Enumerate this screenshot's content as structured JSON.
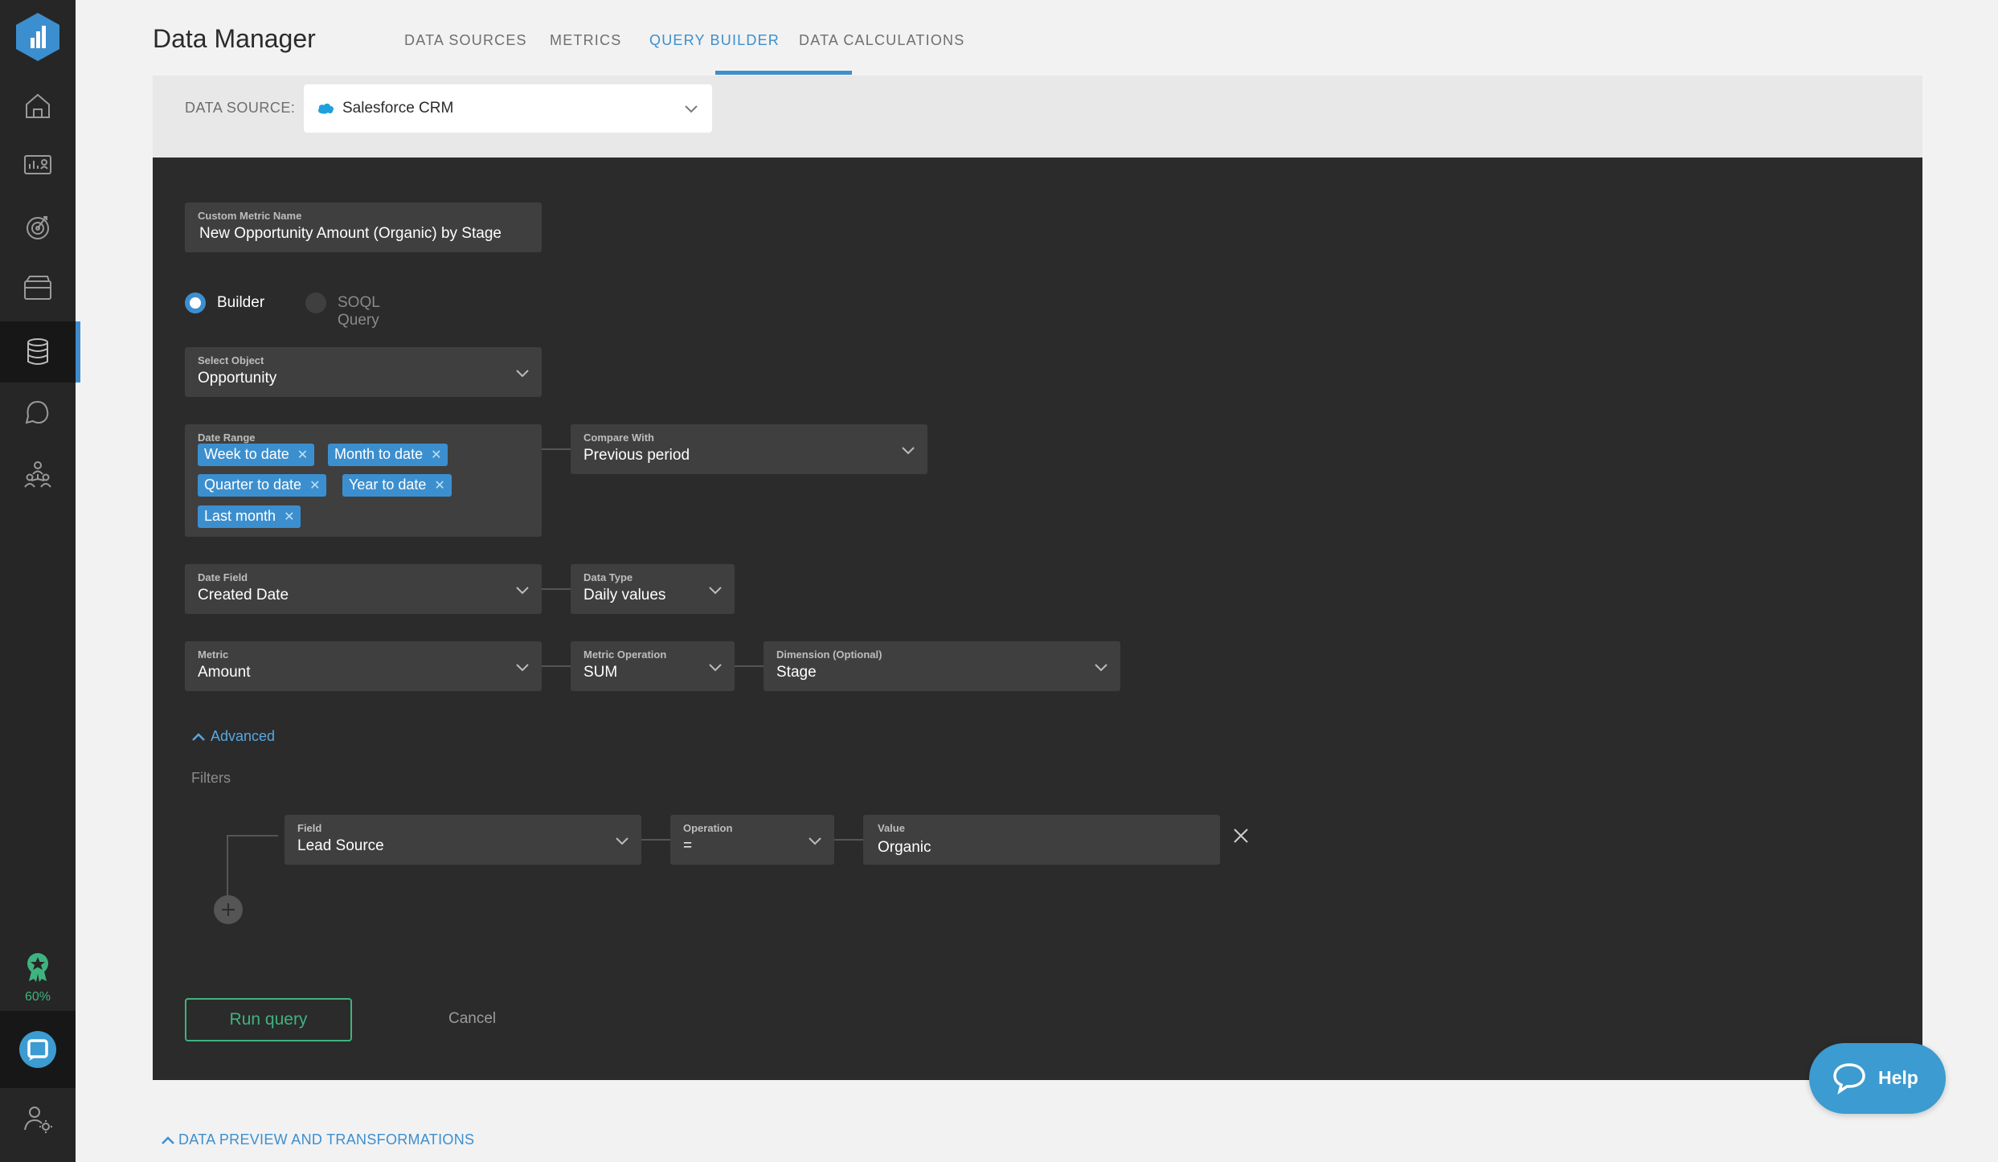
{
  "app": {
    "title": "Data Manager"
  },
  "tabs": [
    {
      "label": "DATA SOURCES"
    },
    {
      "label": "METRICS"
    },
    {
      "label": "QUERY BUILDER"
    },
    {
      "label": "DATA CALCULATIONS"
    }
  ],
  "active_tab": "QUERY BUILDER",
  "sidebar": {
    "items": [
      "home-icon",
      "dashboard-icon",
      "goals-icon",
      "reports-icon",
      "data-icon",
      "alerts-icon",
      "team-icon"
    ],
    "active": "data-icon",
    "progress": "60%"
  },
  "datasource": {
    "label": "DATA SOURCE:",
    "value": "Salesforce CRM"
  },
  "form": {
    "metric_name": {
      "label": "Custom Metric Name",
      "value": "New Opportunity Amount (Organic) by Stage"
    },
    "mode": {
      "builder": "Builder",
      "soql": "SOQL Query",
      "selected": "Builder"
    },
    "object": {
      "label": "Select Object",
      "value": "Opportunity"
    },
    "date_range": {
      "label": "Date Range",
      "chips": [
        "Week to date",
        "Month to date",
        "Quarter to date",
        "Year to date",
        "Last month"
      ]
    },
    "compare_with": {
      "label": "Compare With",
      "value": "Previous period"
    },
    "date_field": {
      "label": "Date Field",
      "value": "Created Date"
    },
    "data_type": {
      "label": "Data Type",
      "value": "Daily values"
    },
    "metric": {
      "label": "Metric",
      "value": "Amount"
    },
    "metric_operation": {
      "label": "Metric Operation",
      "value": "SUM"
    },
    "dimension": {
      "label": "Dimension (Optional)",
      "value": "Stage"
    },
    "advanced_label": "Advanced",
    "filters_label": "Filters",
    "filter": {
      "field": {
        "label": "Field",
        "value": "Lead Source"
      },
      "operation": {
        "label": "Operation",
        "value": "="
      },
      "value": {
        "label": "Value",
        "value": "Organic"
      }
    },
    "run_label": "Run query",
    "cancel_label": "Cancel"
  },
  "preview_label": "DATA PREVIEW AND TRANSFORMATIONS",
  "help_label": "Help",
  "colors": {
    "accent": "#3c8fcf",
    "success": "#3fb37f",
    "panel": "#2b2b2b",
    "sidebar": "#262626"
  }
}
